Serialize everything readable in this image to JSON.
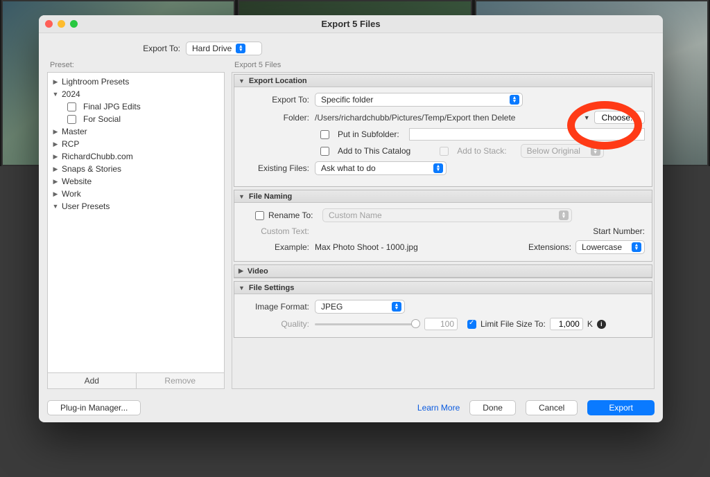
{
  "window": {
    "title": "Export 5 Files"
  },
  "top": {
    "export_to_label": "Export To:",
    "export_to_value": "Hard Drive"
  },
  "preset": {
    "header": "Preset:",
    "add_label": "Add",
    "remove_label": "Remove",
    "tree": [
      {
        "label": "Lightroom Presets",
        "expanded": false
      },
      {
        "label": "2024",
        "expanded": true,
        "children": [
          {
            "label": "Final JPG Edits"
          },
          {
            "label": "For Social"
          }
        ]
      },
      {
        "label": "Master",
        "expanded": false
      },
      {
        "label": "RCP",
        "expanded": false
      },
      {
        "label": "RichardChubb.com",
        "expanded": false
      },
      {
        "label": "Snaps & Stories",
        "expanded": false
      },
      {
        "label": "Website",
        "expanded": false
      },
      {
        "label": "Work",
        "expanded": false
      },
      {
        "label": "User Presets",
        "expanded": true
      }
    ]
  },
  "main": {
    "header": "Export 5 Files",
    "location": {
      "title": "Export Location",
      "export_to_label": "Export To:",
      "export_to_value": "Specific folder",
      "folder_label": "Folder:",
      "folder_value": "/Users/richardchubb/Pictures/Temp/Export then Delete",
      "choose_label": "Choose...",
      "put_in_subfolder": "Put in Subfolder:",
      "add_to_catalog": "Add to This Catalog",
      "add_to_stack": "Add to Stack:",
      "below_original": "Below Original",
      "existing_files_label": "Existing Files:",
      "existing_files_value": "Ask what to do"
    },
    "naming": {
      "title": "File Naming",
      "rename_to": "Rename To:",
      "custom_name_ph": "Custom Name",
      "custom_text": "Custom Text:",
      "start_number": "Start Number:",
      "example_label": "Example:",
      "example_value": "Max Photo Shoot - 1000.jpg",
      "extensions_label": "Extensions:",
      "extensions_value": "Lowercase"
    },
    "video": {
      "title": "Video"
    },
    "settings": {
      "title": "File Settings",
      "format_label": "Image Format:",
      "format_value": "JPEG",
      "quality_label": "Quality:",
      "quality_value": "100",
      "limit_label": "Limit File Size To:",
      "limit_value": "1,000",
      "limit_unit": "K"
    }
  },
  "footer": {
    "plugin_manager": "Plug-in Manager...",
    "learn_more": "Learn More",
    "done": "Done",
    "cancel": "Cancel",
    "export": "Export"
  }
}
